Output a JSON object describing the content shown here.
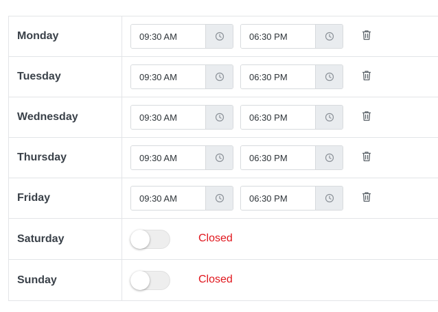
{
  "schedule": {
    "days": [
      {
        "label": "Monday",
        "open": true,
        "start": "09:30 AM",
        "end": "06:30 PM"
      },
      {
        "label": "Tuesday",
        "open": true,
        "start": "09:30 AM",
        "end": "06:30 PM"
      },
      {
        "label": "Wednesday",
        "open": true,
        "start": "09:30 AM",
        "end": "06:30 PM"
      },
      {
        "label": "Thursday",
        "open": true,
        "start": "09:30 AM",
        "end": "06:30 PM"
      },
      {
        "label": "Friday",
        "open": true,
        "start": "09:30 AM",
        "end": "06:30 PM"
      },
      {
        "label": "Saturday",
        "open": false,
        "status": "Closed"
      },
      {
        "label": "Sunday",
        "open": false,
        "status": "Closed"
      }
    ],
    "icons": {
      "time_addon": "clock-icon",
      "delete": "trash-icon"
    },
    "colors": {
      "closed_text": "#e0151c",
      "addon_bg": "#e9ecef",
      "border": "#e2e4e7",
      "toggle_off": "#eeeeee"
    }
  }
}
